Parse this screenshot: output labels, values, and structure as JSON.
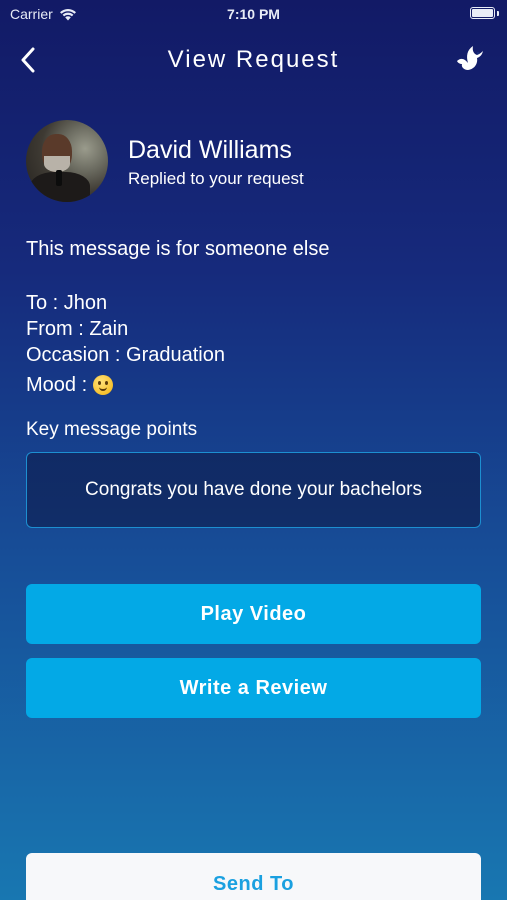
{
  "status_bar": {
    "carrier": "Carrier",
    "time": "7:10 PM"
  },
  "nav": {
    "title": "View Request",
    "back_icon": "chevron-left-icon",
    "action_icon": "dove-icon"
  },
  "profile": {
    "name": "David Williams",
    "status": "Replied to your request"
  },
  "message_intro": "This message is for someone else",
  "details": {
    "to": "To : Jhon",
    "from": "From : Zain",
    "occasion": "Occasion : Graduation",
    "mood_label": "Mood :",
    "mood_icon": "slightly-smiling-face-emoji"
  },
  "key_points": {
    "label": "Key message points",
    "text": "Congrats you have done your bachelors"
  },
  "buttons": {
    "play_video": "Play Video",
    "write_review": "Write a Review",
    "send_to": "Send To"
  },
  "colors": {
    "accent": "#03a9e6",
    "background_top": "#121a66",
    "background_bottom": "#1877b1",
    "send_text": "#1aa0e0"
  }
}
